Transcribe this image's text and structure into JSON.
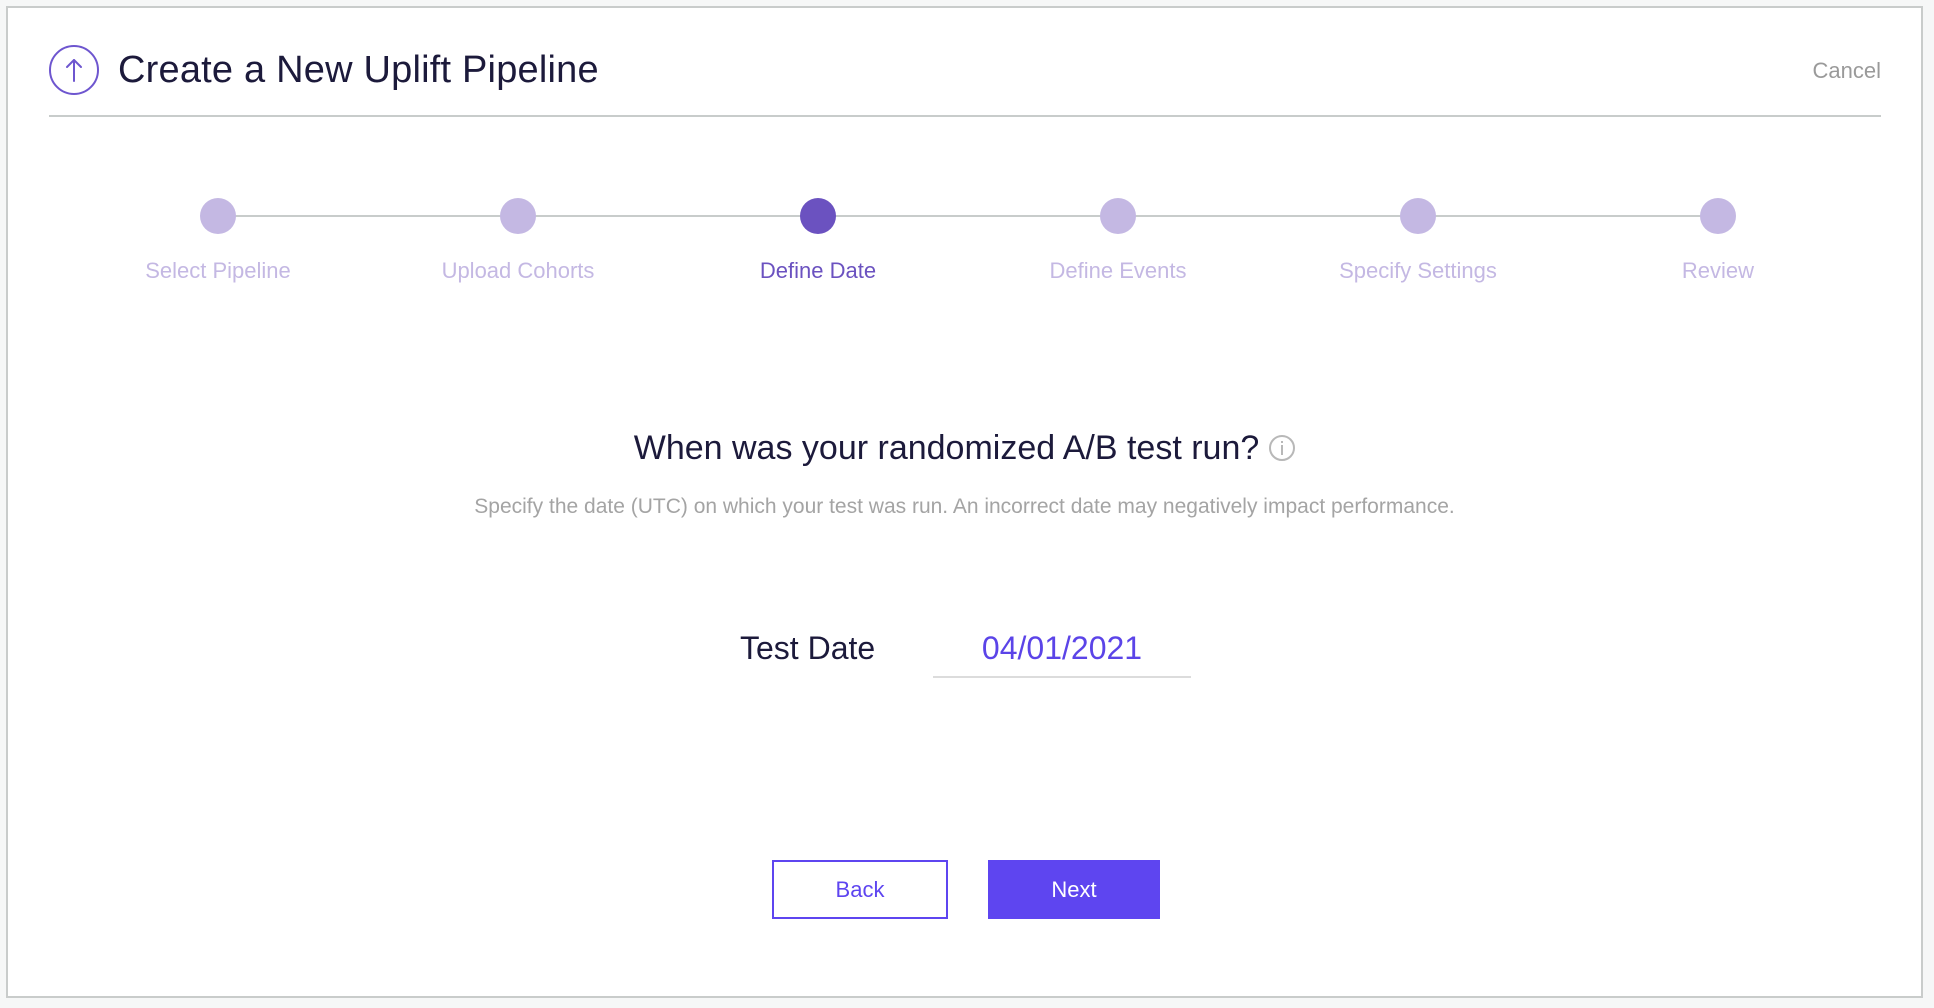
{
  "header": {
    "icon": "arrow-up-circle-icon",
    "title": "Create a New Uplift Pipeline",
    "cancel_label": "Cancel"
  },
  "stepper": {
    "active_index": 2,
    "steps": [
      {
        "label": "Select Pipeline",
        "state": "inactive"
      },
      {
        "label": "Upload Cohorts",
        "state": "inactive"
      },
      {
        "label": "Define Date",
        "state": "active"
      },
      {
        "label": "Define Events",
        "state": "inactive"
      },
      {
        "label": "Specify Settings",
        "state": "inactive"
      },
      {
        "label": "Review",
        "state": "inactive"
      }
    ]
  },
  "question": {
    "title": "When was your randomized A/B test run?",
    "info_icon": "info-circle-icon",
    "subtitle": "Specify the date (UTC) on which your test was run. An incorrect date may negatively impact performance."
  },
  "date_field": {
    "label": "Test Date",
    "value": "04/01/2021"
  },
  "actions": {
    "back_label": "Back",
    "next_label": "Next"
  },
  "colors": {
    "accent": "#5e45f0",
    "step_active": "#6b52c0",
    "step_inactive": "#c4b8e3",
    "title_text": "#1c1a3b",
    "muted_text": "#a4a4a4"
  }
}
